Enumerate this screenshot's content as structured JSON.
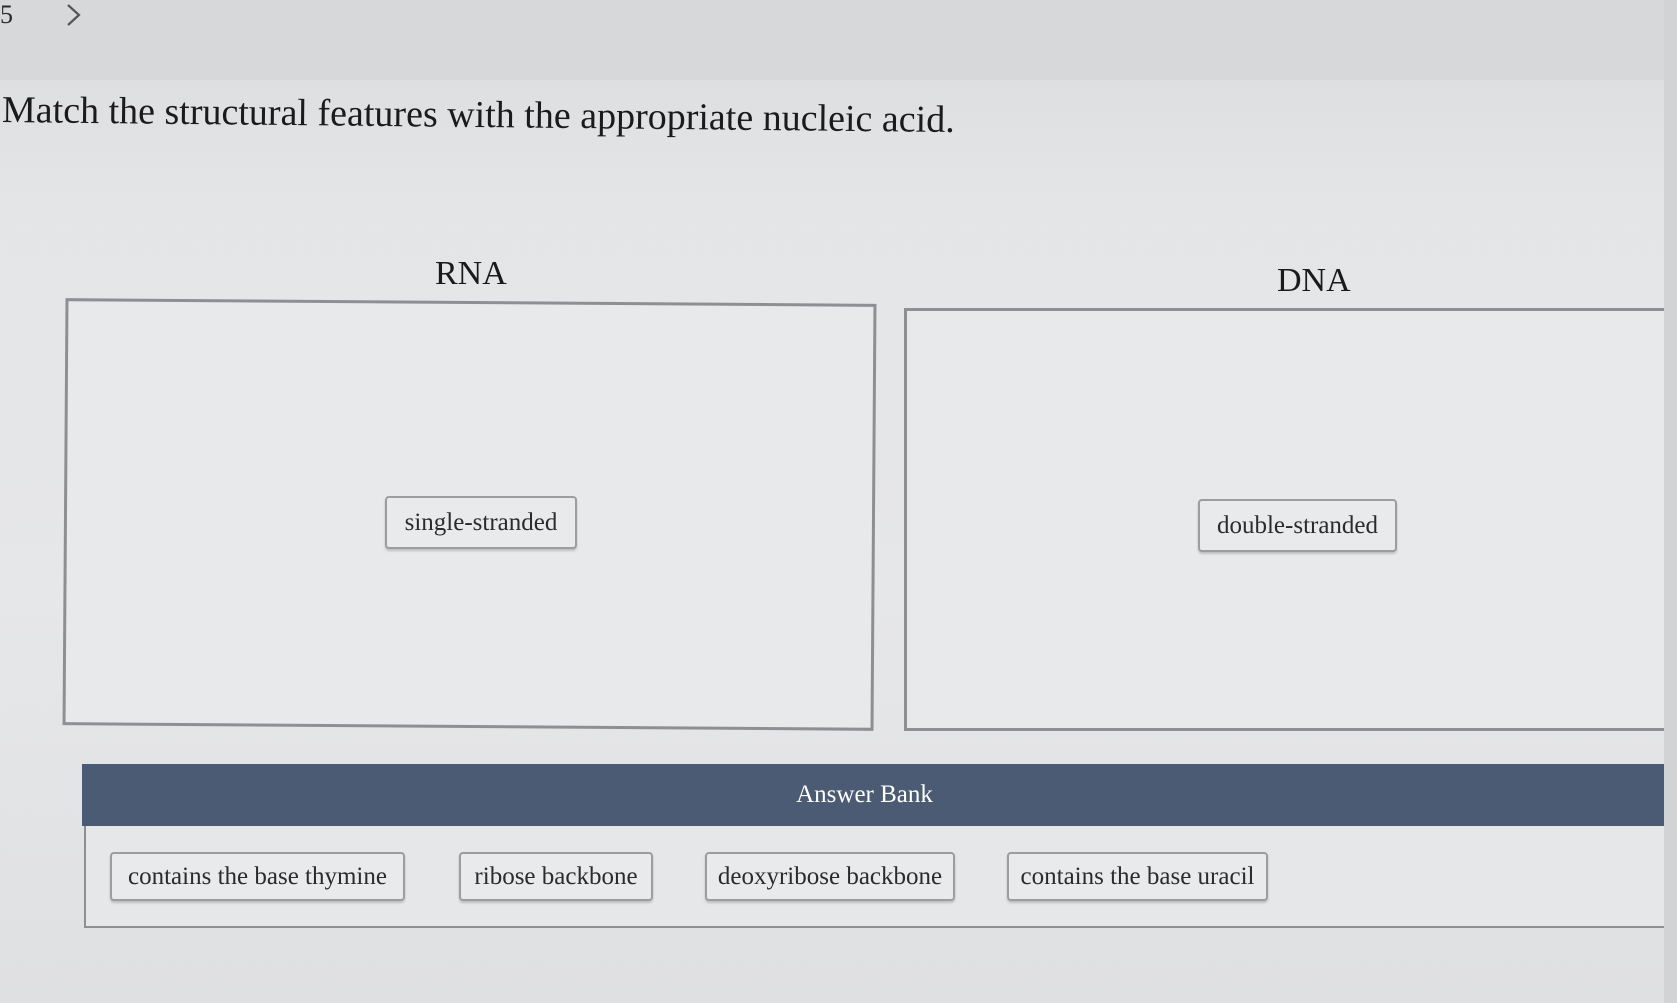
{
  "nav": {
    "question_number": "5"
  },
  "question": {
    "prompt": "Match the structural features with the appropriate nucleic acid."
  },
  "zones": [
    {
      "title": "RNA",
      "placed": [
        "single-stranded"
      ]
    },
    {
      "title": "DNA",
      "placed": [
        "double-stranded"
      ]
    }
  ],
  "answer_bank": {
    "title": "Answer Bank",
    "items": [
      "contains the base thymine",
      "ribose backbone",
      "deoxyribose backbone",
      "contains the base uracil"
    ]
  },
  "icons": {
    "next": "chevron-right-icon"
  }
}
